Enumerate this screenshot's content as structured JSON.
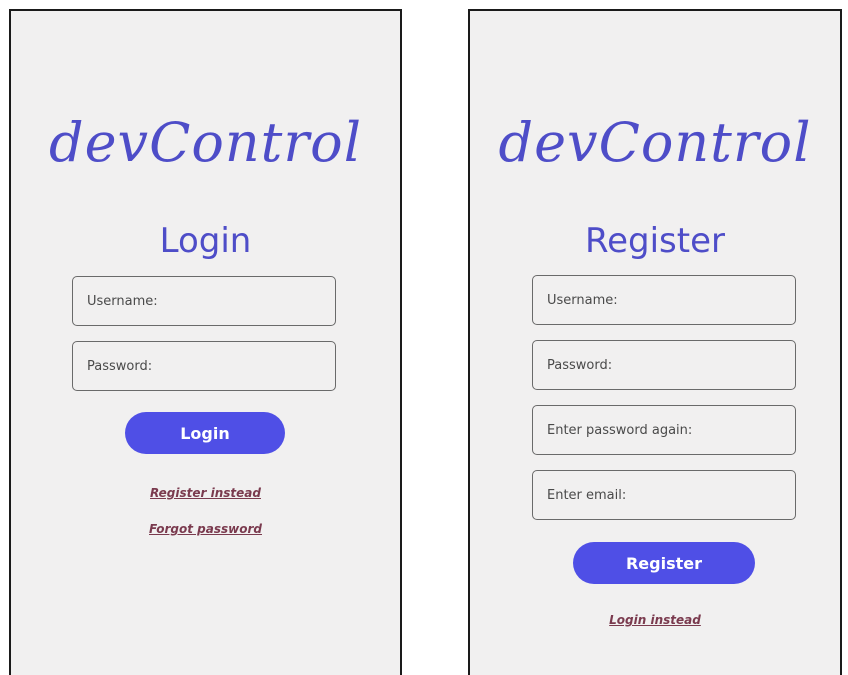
{
  "login": {
    "logo": "devControl",
    "heading": "Login",
    "username_placeholder": "Username:",
    "password_placeholder": "Password:",
    "button_label": "Login",
    "register_link": "Register instead",
    "forgot_link": "Forgot password"
  },
  "register": {
    "logo": "devControl",
    "heading": "Register",
    "username_placeholder": "Username:",
    "password_placeholder": "Password:",
    "password_again_placeholder": "Enter password again:",
    "email_placeholder": "Enter email:",
    "button_label": "Register",
    "login_link": "Login instead"
  },
  "colors": {
    "brand": "#4e4dc8",
    "button": "#4f4fe6",
    "link": "#7a3a4e",
    "background": "#f1f0f0"
  }
}
